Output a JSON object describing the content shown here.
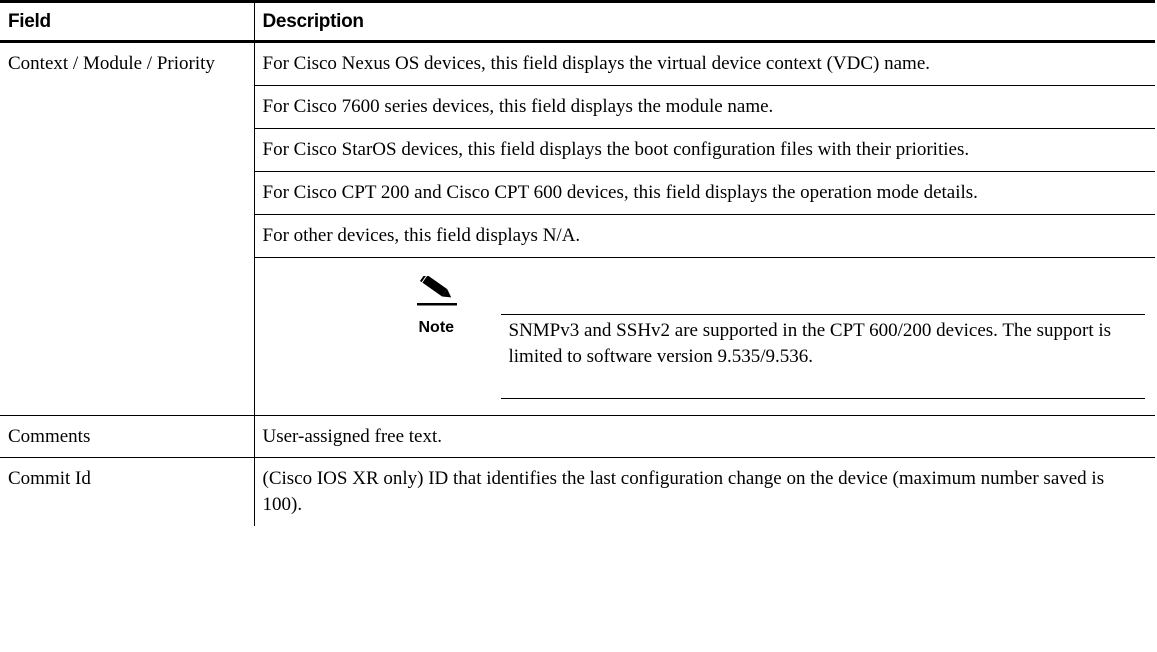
{
  "table": {
    "headers": {
      "field": "Field",
      "description": "Description"
    },
    "rows": [
      {
        "field": "Context / Module / Priority",
        "paragraphs": [
          "For Cisco Nexus OS devices, this field displays the virtual device context (VDC) name.",
          "For Cisco 7600 series devices, this field displays the module name.",
          "For Cisco StarOS devices, this field displays the boot configuration files with their priorities.",
          "For Cisco CPT 200 and Cisco CPT 600 devices, this field displays the operation mode details.",
          "For other devices, this field displays N/A."
        ],
        "note": {
          "label": "Note",
          "icon": "pencil-note-icon",
          "text": "SNMPv3 and SSHv2 are supported in the CPT 600/200 devices. The support is limited to software version 9.535/9.536."
        }
      },
      {
        "field": "Comments",
        "description": "User-assigned free text."
      },
      {
        "field": "Commit Id",
        "description": "(Cisco IOS XR only) ID that identifies the last configuration change on the device (maximum number saved is 100)."
      }
    ]
  }
}
